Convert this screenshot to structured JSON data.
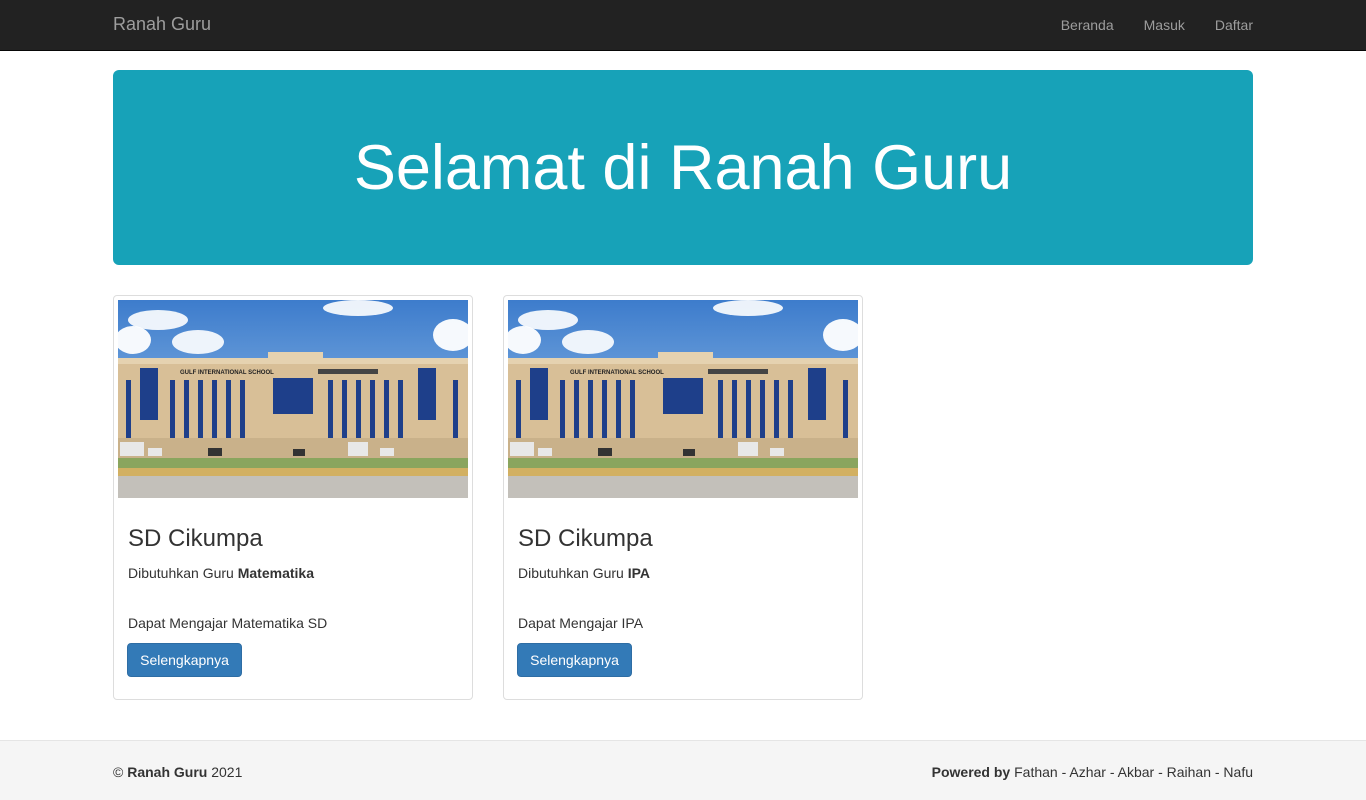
{
  "navbar": {
    "brand": "Ranah Guru",
    "links": [
      "Beranda",
      "Masuk",
      "Daftar"
    ]
  },
  "jumbotron": {
    "title": "Selamat di Ranah Guru"
  },
  "cards": [
    {
      "school": "SD Cikumpa",
      "need_prefix": "Dibutuhkan Guru",
      "subject": "Matematika",
      "description": "Dapat Mengajar Matematika SD",
      "button": "Selengkapnya",
      "image_sign_en": "GULF INTERNATIONAL SCHOOL"
    },
    {
      "school": "SD Cikumpa",
      "need_prefix": "Dibutuhkan Guru",
      "subject": "IPA",
      "description": "Dapat Mengajar IPA",
      "button": "Selengkapnya",
      "image_sign_en": "GULF INTERNATIONAL SCHOOL"
    }
  ],
  "footer": {
    "copyright_symbol": "©",
    "brand": "Ranah Guru",
    "year": "2021",
    "powered_label": "Powered by",
    "authors": "Fathan - Azhar - Akbar - Raihan - Nafu"
  },
  "colors": {
    "navbar_bg": "#222222",
    "jumbotron_bg": "#17a2b8",
    "button_bg": "#337ab7",
    "footer_bg": "#f5f5f5"
  }
}
